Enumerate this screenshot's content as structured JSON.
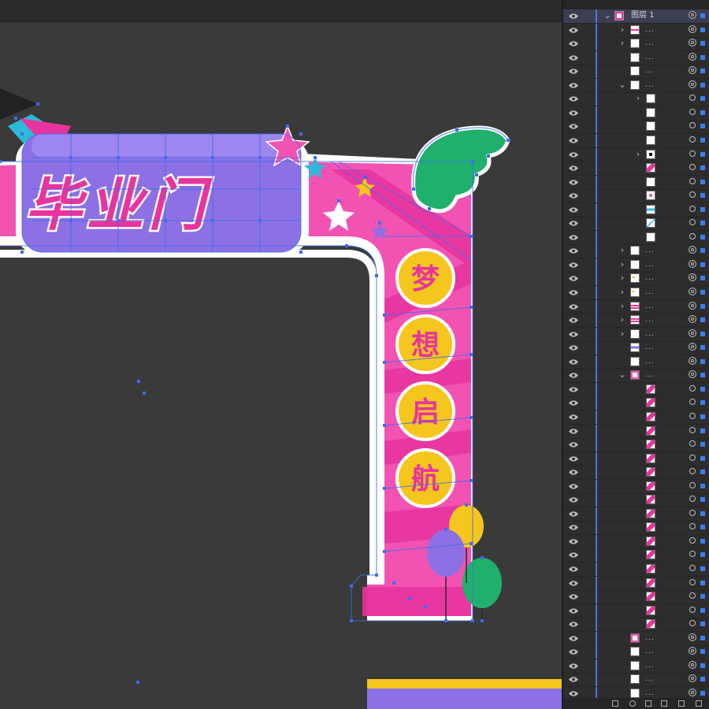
{
  "canvas": {
    "background": "#3a3a3a",
    "artwork": {
      "banner_text": "毕业门",
      "pillar_chars": [
        "梦",
        "想",
        "启",
        "航"
      ],
      "colors": {
        "pink": "#f253b3",
        "hot_pink": "#e8349e",
        "purple": "#8c70e4",
        "yellow": "#f5c61e",
        "green": "#1fb06b",
        "cyan": "#2fb8d8",
        "white": "#ffffff",
        "selection": "#3d6cf0"
      }
    },
    "bottom_stripes": [
      "#f5c61e",
      "#8c70e4"
    ]
  },
  "layers_panel": {
    "top_layer_name": "图层 1",
    "rows": [
      {
        "depth": 0,
        "expand": "open",
        "thumb": "arch",
        "name": "图层 1",
        "selected": true
      },
      {
        "depth": 1,
        "expand": "closed",
        "thumb": "text-pink",
        "name": "..."
      },
      {
        "depth": 1,
        "expand": "closed",
        "thumb": "white",
        "name": "..."
      },
      {
        "depth": 1,
        "expand": "none",
        "thumb": "star-cyan",
        "name": "..."
      },
      {
        "depth": 1,
        "expand": "none",
        "thumb": "star-pink",
        "name": "..."
      },
      {
        "depth": 1,
        "expand": "open",
        "thumb": "cap",
        "name": "..."
      },
      {
        "depth": 2,
        "expand": "closed",
        "thumb": "white",
        "name": ""
      },
      {
        "depth": 2,
        "expand": "none",
        "thumb": "white",
        "name": ""
      },
      {
        "depth": 2,
        "expand": "none",
        "thumb": "white",
        "name": ""
      },
      {
        "depth": 2,
        "expand": "none",
        "thumb": "white",
        "name": ""
      },
      {
        "depth": 2,
        "expand": "closed",
        "thumb": "cap-black",
        "name": ""
      },
      {
        "depth": 2,
        "expand": "none",
        "thumb": "pink-slash",
        "name": ""
      },
      {
        "depth": 2,
        "expand": "none",
        "thumb": "white",
        "name": ""
      },
      {
        "depth": 2,
        "expand": "none",
        "thumb": "pink-small",
        "name": ""
      },
      {
        "depth": 2,
        "expand": "none",
        "thumb": "cyan-bar",
        "name": ""
      },
      {
        "depth": 2,
        "expand": "none",
        "thumb": "cyan-line",
        "name": ""
      },
      {
        "depth": 2,
        "expand": "none",
        "thumb": "white",
        "name": ""
      },
      {
        "depth": 1,
        "expand": "closed",
        "thumb": "white",
        "name": "..."
      },
      {
        "depth": 1,
        "expand": "closed",
        "thumb": "white",
        "name": "..."
      },
      {
        "depth": 1,
        "expand": "closed",
        "thumb": "yellow-dots",
        "name": "..."
      },
      {
        "depth": 1,
        "expand": "closed",
        "thumb": "yellow-dots",
        "name": "..."
      },
      {
        "depth": 1,
        "expand": "closed",
        "thumb": "pink-bar",
        "name": "..."
      },
      {
        "depth": 1,
        "expand": "closed",
        "thumb": "pink-bar",
        "name": "..."
      },
      {
        "depth": 1,
        "expand": "closed",
        "thumb": "white",
        "name": "..."
      },
      {
        "depth": 1,
        "expand": "none",
        "thumb": "purple-bar",
        "name": "..."
      },
      {
        "depth": 1,
        "expand": "none",
        "thumb": "white",
        "name": "..."
      },
      {
        "depth": 1,
        "expand": "open",
        "thumb": "arch-small",
        "name": "..."
      },
      {
        "depth": 2,
        "expand": "none",
        "thumb": "pink-slash",
        "name": ""
      },
      {
        "depth": 2,
        "expand": "none",
        "thumb": "pink-slash",
        "name": ""
      },
      {
        "depth": 2,
        "expand": "none",
        "thumb": "pink-slash",
        "name": ""
      },
      {
        "depth": 2,
        "expand": "none",
        "thumb": "pink-slash",
        "name": ""
      },
      {
        "depth": 2,
        "expand": "none",
        "thumb": "pink-slash",
        "name": ""
      },
      {
        "depth": 2,
        "expand": "none",
        "thumb": "pink-slash",
        "name": ""
      },
      {
        "depth": 2,
        "expand": "none",
        "thumb": "pink-slash",
        "name": ""
      },
      {
        "depth": 2,
        "expand": "none",
        "thumb": "pink-slash",
        "name": ""
      },
      {
        "depth": 2,
        "expand": "none",
        "thumb": "pink-slash",
        "name": ""
      },
      {
        "depth": 2,
        "expand": "none",
        "thumb": "pink-slash",
        "name": ""
      },
      {
        "depth": 2,
        "expand": "none",
        "thumb": "pink-slash",
        "name": ""
      },
      {
        "depth": 2,
        "expand": "none",
        "thumb": "pink-slash",
        "name": ""
      },
      {
        "depth": 2,
        "expand": "none",
        "thumb": "pink-slash",
        "name": ""
      },
      {
        "depth": 2,
        "expand": "none",
        "thumb": "pink-slash",
        "name": ""
      },
      {
        "depth": 2,
        "expand": "none",
        "thumb": "pink-slash",
        "name": ""
      },
      {
        "depth": 2,
        "expand": "none",
        "thumb": "pink-slash",
        "name": ""
      },
      {
        "depth": 2,
        "expand": "none",
        "thumb": "pink-slash",
        "name": ""
      },
      {
        "depth": 2,
        "expand": "none",
        "thumb": "pink-slash",
        "name": ""
      },
      {
        "depth": 1,
        "expand": "none",
        "thumb": "pink-frame",
        "name": "..."
      },
      {
        "depth": 1,
        "expand": "none",
        "thumb": "white",
        "name": "..."
      },
      {
        "depth": 1,
        "expand": "none",
        "thumb": "white",
        "name": "..."
      },
      {
        "depth": 1,
        "expand": "none",
        "thumb": "white",
        "name": "..."
      },
      {
        "depth": 1,
        "expand": "none",
        "thumb": "white",
        "name": "..."
      }
    ]
  }
}
